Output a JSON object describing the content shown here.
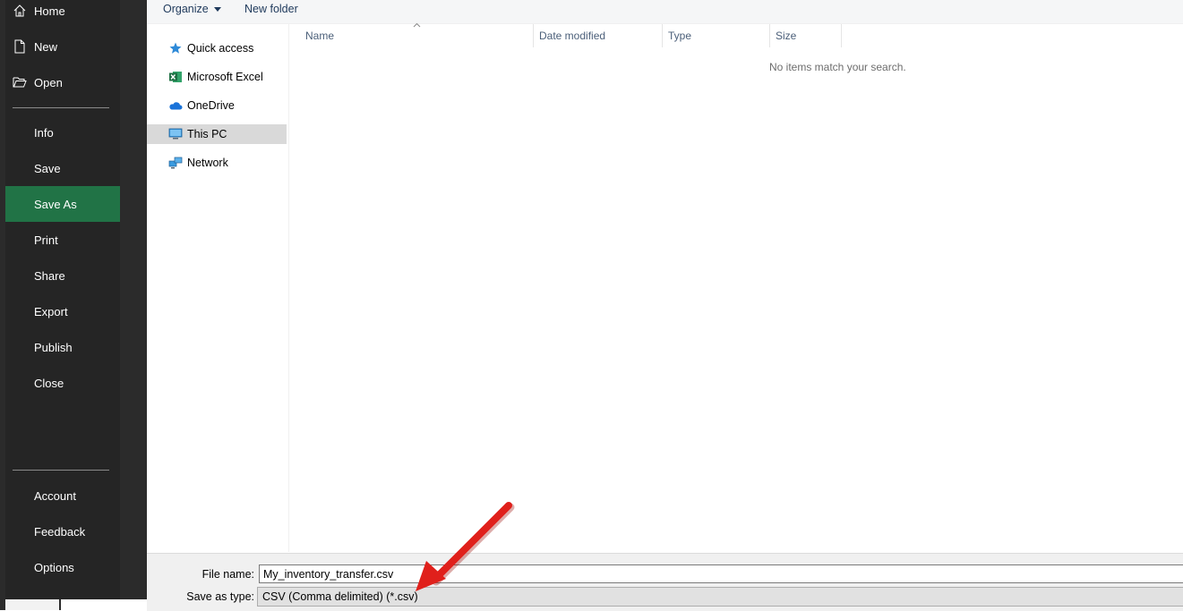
{
  "backstage": {
    "top_items": [
      {
        "label": "Home",
        "icon": "home-icon"
      },
      {
        "label": "New",
        "icon": "new-document-icon"
      },
      {
        "label": "Open",
        "icon": "open-folder-icon"
      }
    ],
    "middle_items": [
      {
        "label": "Info"
      },
      {
        "label": "Save"
      },
      {
        "label": "Save As",
        "active": true
      },
      {
        "label": "Print"
      },
      {
        "label": "Share"
      },
      {
        "label": "Export"
      },
      {
        "label": "Publish"
      },
      {
        "label": "Close"
      }
    ],
    "bottom_items": [
      {
        "label": "Account"
      },
      {
        "label": "Feedback"
      },
      {
        "label": "Options"
      }
    ],
    "active_color": "#217346"
  },
  "dialog": {
    "toolbar": {
      "organize_label": "Organize",
      "new_folder_label": "New folder"
    },
    "nav_pane": {
      "items": [
        {
          "label": "Quick access",
          "icon": "star-pin-icon"
        },
        {
          "label": "Microsoft Excel",
          "icon": "excel-icon"
        },
        {
          "label": "OneDrive",
          "icon": "cloud-icon"
        },
        {
          "label": "This PC",
          "icon": "computer-icon",
          "selected": true
        },
        {
          "label": "Network",
          "icon": "network-icon"
        }
      ]
    },
    "file_list": {
      "columns": [
        "Name",
        "Date modified",
        "Type",
        "Size"
      ],
      "empty_message": "No items match your search."
    },
    "file_name": {
      "label": "File name:",
      "value": "My_inventory_transfer.csv"
    },
    "save_as_type": {
      "label": "Save as type:",
      "value": "CSV (Comma delimited) (*.csv)"
    }
  },
  "annotation": {
    "arrow_color": "#e0201b",
    "icon": "red-arrow-annotation"
  }
}
